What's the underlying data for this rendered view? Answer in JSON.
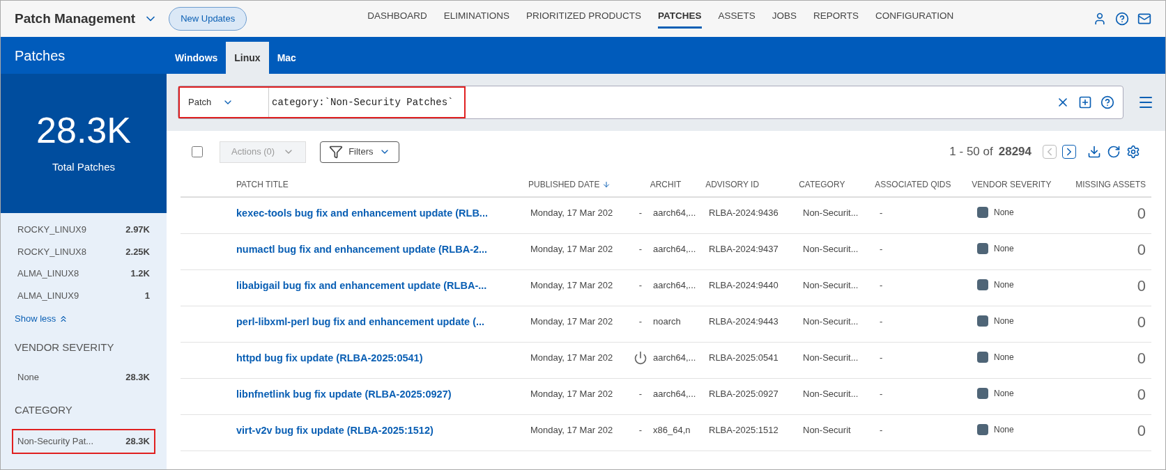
{
  "app": {
    "title": "Patch Management",
    "badge": "New Updates"
  },
  "nav": [
    {
      "label": "DASHBOARD",
      "selected": false
    },
    {
      "label": "ELIMINATIONS",
      "selected": false
    },
    {
      "label": "PRIORITIZED PRODUCTS",
      "selected": false
    },
    {
      "label": "PATCHES",
      "selected": true
    },
    {
      "label": "ASSETS",
      "selected": false
    },
    {
      "label": "JOBS",
      "selected": false
    },
    {
      "label": "REPORTS",
      "selected": false
    },
    {
      "label": "CONFIGURATION",
      "selected": false
    }
  ],
  "page_title": "Patches",
  "tabs": [
    {
      "label": "Windows",
      "selected": false
    },
    {
      "label": "Linux",
      "selected": true
    },
    {
      "label": "Mac",
      "selected": false
    }
  ],
  "search": {
    "scope": "Patch",
    "value": "category:`Non-Security Patches`",
    "highlighted": true
  },
  "sidebar": {
    "total": "28.3K",
    "total_label": "Total Patches",
    "os": [
      {
        "label": "ROCKY_LINUX9",
        "count": "2.97K",
        "highlighted": false
      },
      {
        "label": "ROCKY_LINUX8",
        "count": "2.25K",
        "highlighted": false
      },
      {
        "label": "ALMA_LINUX8",
        "count": "1.2K",
        "highlighted": false
      },
      {
        "label": "ALMA_LINUX9",
        "count": "1",
        "highlighted": false
      }
    ],
    "show_less": "Show less",
    "groups": [
      {
        "title": "VENDOR SEVERITY",
        "items": [
          {
            "label": "None",
            "count": "28.3K",
            "highlighted": false
          }
        ]
      },
      {
        "title": "CATEGORY",
        "items": [
          {
            "label": "Non-Security Pat...",
            "count": "28.3K",
            "highlighted": true
          }
        ]
      }
    ]
  },
  "toolbar": {
    "checked": false,
    "actions": "Actions (0)",
    "filters": "Filters",
    "range": "1 - 50 of",
    "total": "28294"
  },
  "table": {
    "columns": [
      "PATCH TITLE",
      "PUBLISHED DATE",
      "ARCHIT",
      "ADVISORY ID",
      "CATEGORY",
      "ASSOCIATED QIDS",
      "VENDOR SEVERITY",
      "MISSING ASSETS"
    ],
    "rows": [
      {
        "title": "kexec-tools bug fix and enhancement update (RLB...",
        "date": "Monday, 17 Mar 202",
        "column_3": {
          "kind": "text",
          "text": "-"
        },
        "arch": "aarch64,...",
        "advisory": "RLBA-2024:9436",
        "category": "Non-Securit...",
        "qids": "-",
        "severity": "None",
        "missing": "0"
      },
      {
        "title": "numactl bug fix and enhancement update (RLBA-2...",
        "date": "Monday, 17 Mar 202",
        "column_3": {
          "kind": "text",
          "text": "-"
        },
        "arch": "aarch64,...",
        "advisory": "RLBA-2024:9437",
        "category": "Non-Securit...",
        "qids": "-",
        "severity": "None",
        "missing": "0"
      },
      {
        "title": "libabigail bug fix and enhancement update (RLBA-...",
        "date": "Monday, 17 Mar 202",
        "column_3": {
          "kind": "text",
          "text": "-"
        },
        "arch": "aarch64,...",
        "advisory": "RLBA-2024:9440",
        "category": "Non-Securit...",
        "qids": "-",
        "severity": "None",
        "missing": "0"
      },
      {
        "title": "perl-libxml-perl bug fix and enhancement update (...",
        "date": "Monday, 17 Mar 202",
        "column_3": {
          "kind": "text",
          "text": "-"
        },
        "arch": "noarch",
        "advisory": "RLBA-2024:9443",
        "category": "Non-Securit...",
        "qids": "-",
        "severity": "None",
        "missing": "0"
      },
      {
        "title": "httpd bug fix update (RLBA-2025:0541)",
        "date": "Monday, 17 Mar 202",
        "column_3": {
          "kind": "icon"
        },
        "arch": "aarch64,...",
        "advisory": "RLBA-2025:0541",
        "category": "Non-Securit...",
        "qids": "-",
        "severity": "None",
        "missing": "0"
      },
      {
        "title": "libnfnetlink bug fix update (RLBA-2025:0927)",
        "date": "Monday, 17 Mar 202",
        "column_3": {
          "kind": "text",
          "text": "-"
        },
        "arch": "aarch64,...",
        "advisory": "RLBA-2025:0927",
        "category": "Non-Securit...",
        "qids": "-",
        "severity": "None",
        "missing": "0"
      },
      {
        "title": "virt-v2v bug fix update (RLBA-2025:1512)",
        "date": "Monday, 17 Mar 202",
        "column_3": {
          "kind": "text",
          "text": "-"
        },
        "arch": "x86_64,n",
        "advisory": "RLBA-2025:1512",
        "category": "Non-Securit",
        "qids": "-",
        "severity": "None",
        "missing": "0"
      }
    ]
  }
}
